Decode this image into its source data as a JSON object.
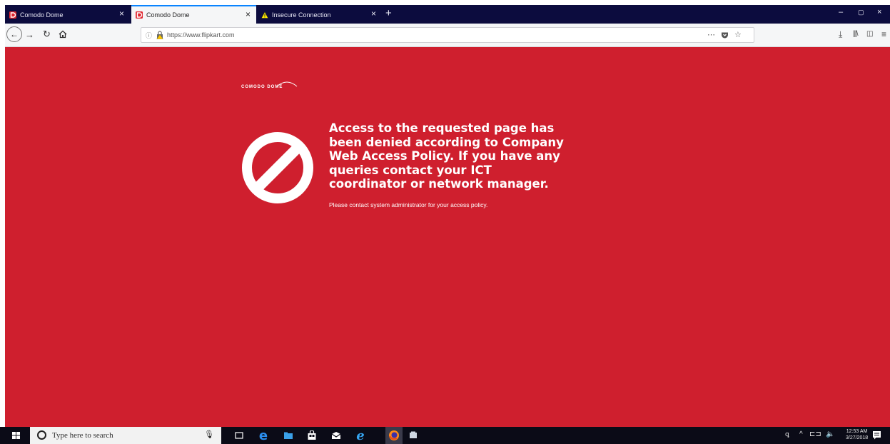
{
  "browser": {
    "tabs": [
      {
        "label": "Comodo Dome",
        "icon": "comodo-dome-icon"
      },
      {
        "label": "Comodo Dome",
        "icon": "comodo-dome-icon"
      },
      {
        "label": "Insecure Connection",
        "icon": "warning-icon"
      }
    ],
    "active_tab_index": 1,
    "new_tab_label": "+",
    "url": "https://www.flipkart.com"
  },
  "page": {
    "logo_text": "COMODO DOME",
    "message": "Access to the requested page has been denied according to Company Web Access Policy. If you have any queries contact your ICT coordinator or network manager.",
    "sub_message": "Please contact system administrator for your access policy.",
    "background_color": "#cf1f2e"
  },
  "taskbar": {
    "search_placeholder": "Type here to search",
    "time": "12:53 AM",
    "date": "3/27/2018"
  }
}
